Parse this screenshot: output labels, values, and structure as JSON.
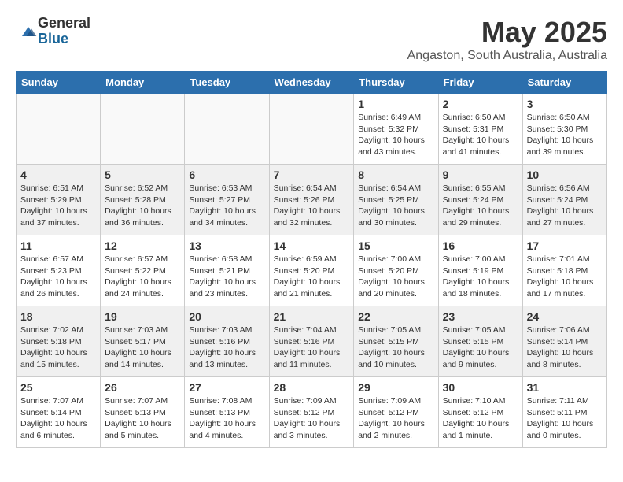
{
  "logo": {
    "general": "General",
    "blue": "Blue"
  },
  "title": "May 2025",
  "location": "Angaston, South Australia, Australia",
  "weekdays": [
    "Sunday",
    "Monday",
    "Tuesday",
    "Wednesday",
    "Thursday",
    "Friday",
    "Saturday"
  ],
  "weeks": [
    [
      {
        "day": "",
        "info": ""
      },
      {
        "day": "",
        "info": ""
      },
      {
        "day": "",
        "info": ""
      },
      {
        "day": "",
        "info": ""
      },
      {
        "day": "1",
        "info": "Sunrise: 6:49 AM\nSunset: 5:32 PM\nDaylight: 10 hours\nand 43 minutes."
      },
      {
        "day": "2",
        "info": "Sunrise: 6:50 AM\nSunset: 5:31 PM\nDaylight: 10 hours\nand 41 minutes."
      },
      {
        "day": "3",
        "info": "Sunrise: 6:50 AM\nSunset: 5:30 PM\nDaylight: 10 hours\nand 39 minutes."
      }
    ],
    [
      {
        "day": "4",
        "info": "Sunrise: 6:51 AM\nSunset: 5:29 PM\nDaylight: 10 hours\nand 37 minutes."
      },
      {
        "day": "5",
        "info": "Sunrise: 6:52 AM\nSunset: 5:28 PM\nDaylight: 10 hours\nand 36 minutes."
      },
      {
        "day": "6",
        "info": "Sunrise: 6:53 AM\nSunset: 5:27 PM\nDaylight: 10 hours\nand 34 minutes."
      },
      {
        "day": "7",
        "info": "Sunrise: 6:54 AM\nSunset: 5:26 PM\nDaylight: 10 hours\nand 32 minutes."
      },
      {
        "day": "8",
        "info": "Sunrise: 6:54 AM\nSunset: 5:25 PM\nDaylight: 10 hours\nand 30 minutes."
      },
      {
        "day": "9",
        "info": "Sunrise: 6:55 AM\nSunset: 5:24 PM\nDaylight: 10 hours\nand 29 minutes."
      },
      {
        "day": "10",
        "info": "Sunrise: 6:56 AM\nSunset: 5:24 PM\nDaylight: 10 hours\nand 27 minutes."
      }
    ],
    [
      {
        "day": "11",
        "info": "Sunrise: 6:57 AM\nSunset: 5:23 PM\nDaylight: 10 hours\nand 26 minutes."
      },
      {
        "day": "12",
        "info": "Sunrise: 6:57 AM\nSunset: 5:22 PM\nDaylight: 10 hours\nand 24 minutes."
      },
      {
        "day": "13",
        "info": "Sunrise: 6:58 AM\nSunset: 5:21 PM\nDaylight: 10 hours\nand 23 minutes."
      },
      {
        "day": "14",
        "info": "Sunrise: 6:59 AM\nSunset: 5:20 PM\nDaylight: 10 hours\nand 21 minutes."
      },
      {
        "day": "15",
        "info": "Sunrise: 7:00 AM\nSunset: 5:20 PM\nDaylight: 10 hours\nand 20 minutes."
      },
      {
        "day": "16",
        "info": "Sunrise: 7:00 AM\nSunset: 5:19 PM\nDaylight: 10 hours\nand 18 minutes."
      },
      {
        "day": "17",
        "info": "Sunrise: 7:01 AM\nSunset: 5:18 PM\nDaylight: 10 hours\nand 17 minutes."
      }
    ],
    [
      {
        "day": "18",
        "info": "Sunrise: 7:02 AM\nSunset: 5:18 PM\nDaylight: 10 hours\nand 15 minutes."
      },
      {
        "day": "19",
        "info": "Sunrise: 7:03 AM\nSunset: 5:17 PM\nDaylight: 10 hours\nand 14 minutes."
      },
      {
        "day": "20",
        "info": "Sunrise: 7:03 AM\nSunset: 5:16 PM\nDaylight: 10 hours\nand 13 minutes."
      },
      {
        "day": "21",
        "info": "Sunrise: 7:04 AM\nSunset: 5:16 PM\nDaylight: 10 hours\nand 11 minutes."
      },
      {
        "day": "22",
        "info": "Sunrise: 7:05 AM\nSunset: 5:15 PM\nDaylight: 10 hours\nand 10 minutes."
      },
      {
        "day": "23",
        "info": "Sunrise: 7:05 AM\nSunset: 5:15 PM\nDaylight: 10 hours\nand 9 minutes."
      },
      {
        "day": "24",
        "info": "Sunrise: 7:06 AM\nSunset: 5:14 PM\nDaylight: 10 hours\nand 8 minutes."
      }
    ],
    [
      {
        "day": "25",
        "info": "Sunrise: 7:07 AM\nSunset: 5:14 PM\nDaylight: 10 hours\nand 6 minutes."
      },
      {
        "day": "26",
        "info": "Sunrise: 7:07 AM\nSunset: 5:13 PM\nDaylight: 10 hours\nand 5 minutes."
      },
      {
        "day": "27",
        "info": "Sunrise: 7:08 AM\nSunset: 5:13 PM\nDaylight: 10 hours\nand 4 minutes."
      },
      {
        "day": "28",
        "info": "Sunrise: 7:09 AM\nSunset: 5:12 PM\nDaylight: 10 hours\nand 3 minutes."
      },
      {
        "day": "29",
        "info": "Sunrise: 7:09 AM\nSunset: 5:12 PM\nDaylight: 10 hours\nand 2 minutes."
      },
      {
        "day": "30",
        "info": "Sunrise: 7:10 AM\nSunset: 5:12 PM\nDaylight: 10 hours\nand 1 minute."
      },
      {
        "day": "31",
        "info": "Sunrise: 7:11 AM\nSunset: 5:11 PM\nDaylight: 10 hours\nand 0 minutes."
      }
    ]
  ]
}
